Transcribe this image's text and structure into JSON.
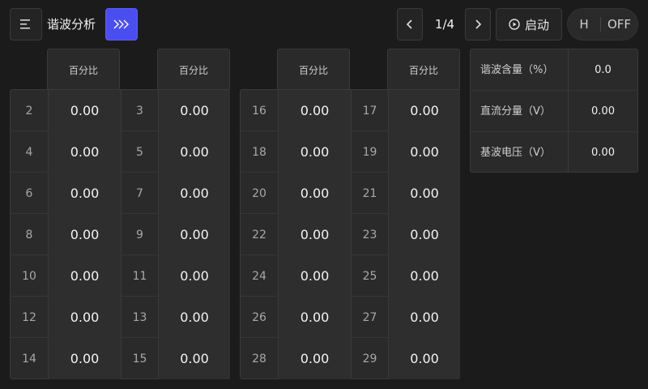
{
  "header": {
    "title": "谐波分析",
    "menu_icon": "menu-icon",
    "forward_icon": "triple-chevron-right-icon",
    "page_indicator": "1/4",
    "start_label": "启动",
    "toggle_left": "H",
    "toggle_right": "OFF",
    "accent_color": "#4a4ef0"
  },
  "column_header": "百分比",
  "table_left": {
    "rows": [
      [
        "2",
        "0.00",
        "3",
        "0.00"
      ],
      [
        "4",
        "0.00",
        "5",
        "0.00"
      ],
      [
        "6",
        "0.00",
        "7",
        "0.00"
      ],
      [
        "8",
        "0.00",
        "9",
        "0.00"
      ],
      [
        "10",
        "0.00",
        "11",
        "0.00"
      ],
      [
        "12",
        "0.00",
        "13",
        "0.00"
      ],
      [
        "14",
        "0.00",
        "15",
        "0.00"
      ]
    ]
  },
  "table_right": {
    "rows": [
      [
        "16",
        "0.00",
        "17",
        "0.00"
      ],
      [
        "18",
        "0.00",
        "19",
        "0.00"
      ],
      [
        "20",
        "0.00",
        "21",
        "0.00"
      ],
      [
        "22",
        "0.00",
        "23",
        "0.00"
      ],
      [
        "24",
        "0.00",
        "25",
        "0.00"
      ],
      [
        "26",
        "0.00",
        "27",
        "0.00"
      ],
      [
        "28",
        "0.00",
        "29",
        "0.00"
      ]
    ]
  },
  "info": [
    {
      "label": "谐波含量（%）",
      "value": "0.0"
    },
    {
      "label": "直流分量（V）",
      "value": "0.00"
    },
    {
      "label": "基波电压（V）",
      "value": "0.00"
    }
  ]
}
